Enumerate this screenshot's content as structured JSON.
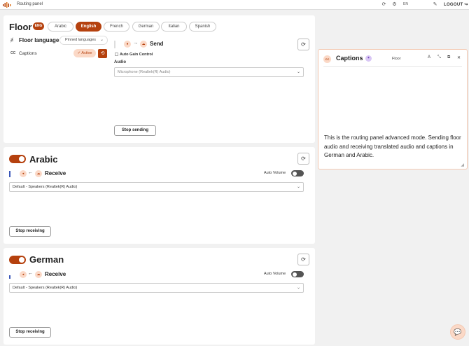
{
  "app": {
    "title": "Routing panel",
    "lang_short": "EN",
    "logout_label": "LOGOUT"
  },
  "floor": {
    "title": "Floor",
    "badge": "ENG",
    "languages": [
      "Arabic",
      "English",
      "French",
      "German",
      "Italian",
      "Spanish"
    ],
    "active_language": "English",
    "floor_language_label": "Floor language",
    "pinned_languages_label": "Pinned languages",
    "captions_label": "Captions",
    "active_label": "Active",
    "send_label": "Send",
    "auto_gain_label": "Auto Gain Control",
    "audio_label": "Audio",
    "microphone_value": "Microphone (Realtek(R) Audio)",
    "stop_sending_label": "Stop sending"
  },
  "receivers": [
    {
      "title": "Arabic",
      "receive_label": "Receive",
      "auto_volume_label": "Auto Volume",
      "speaker_value": "Default - Speakers (Realtek(R) Audio)",
      "stop_label": "Stop receiving"
    },
    {
      "title": "German",
      "receive_label": "Receive",
      "auto_volume_label": "Auto Volume",
      "speaker_value": "Default - Speakers (Realtek(R) Audio)",
      "stop_label": "Stop receiving"
    }
  ],
  "captions_panel": {
    "title": "Captions",
    "source": "Floor",
    "text": "This is the routing panel advanced mode. Sending floor audio and receiving translated audio and captions in German and Arabic."
  },
  "colors": {
    "accent": "#b5410e",
    "accent_light": "#fbd9c7",
    "level_bar": "#3a56b8"
  }
}
